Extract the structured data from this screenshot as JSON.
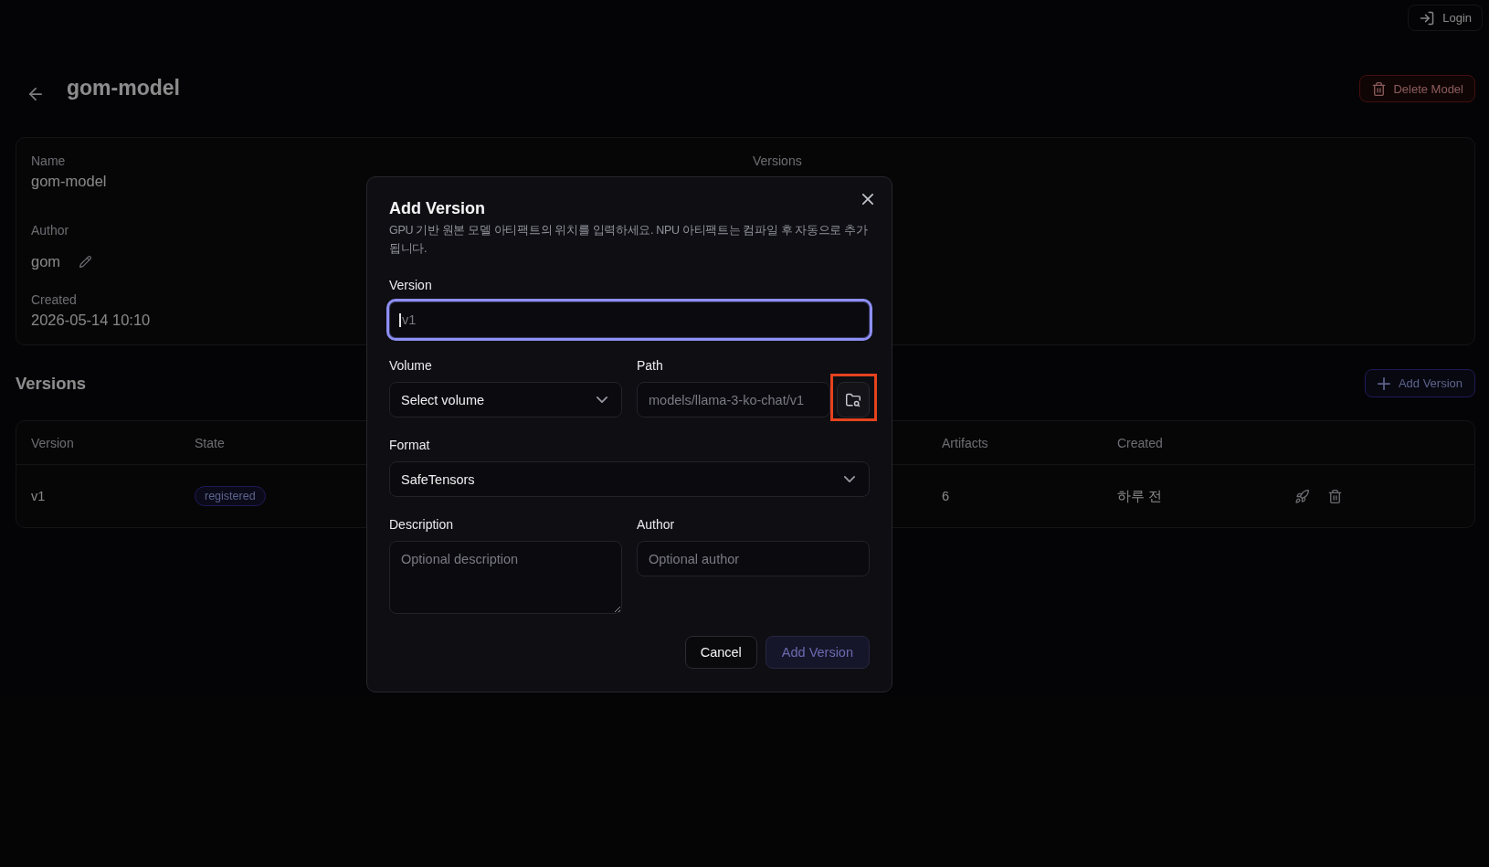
{
  "topbar": {
    "login_button": "Login"
  },
  "header": {
    "title": "gom-model",
    "delete_button": "Delete Model"
  },
  "details": {
    "left_column": [
      {
        "label": "Name",
        "value": "gom-model",
        "editable": false
      },
      {
        "label": "Author",
        "value": "gom",
        "editable": true
      },
      {
        "label": "Created",
        "value": "2026-05-14 10:10",
        "editable": false
      }
    ],
    "right_column": [
      {
        "label": "Versions"
      }
    ]
  },
  "versions": {
    "title": "Versions",
    "add_button": "Add Version",
    "table": {
      "columns": [
        "Version",
        "State",
        "Artifacts",
        "Created"
      ],
      "rows": [
        {
          "version": "v1",
          "state": "registered",
          "artifacts": "6",
          "created": "하루 전"
        }
      ]
    }
  },
  "dialog": {
    "title": "Add Version",
    "description": "GPU 기반 원본 모델 아티팩트의 위치를 입력하세요. NPU 아티팩트는 컴파일 후 자동으로 추가됩니다.",
    "rows": [
      [
        {
          "kind": "input",
          "label": "Version",
          "placeholder": "v1",
          "focused": true
        }
      ],
      [
        {
          "kind": "select",
          "label": "Volume",
          "value": "Select volume"
        },
        {
          "kind": "path",
          "label": "Path",
          "placeholder": "models/llama-3-ko-chat/v1",
          "highlighted": true
        }
      ],
      [
        {
          "kind": "select",
          "label": "Format",
          "value": "SafeTensors"
        }
      ],
      [
        {
          "kind": "textarea",
          "label": "Description",
          "placeholder": "Optional description"
        },
        {
          "kind": "input",
          "label": "Author",
          "placeholder": "Optional author",
          "focused": false
        }
      ]
    ],
    "buttons": [
      {
        "label": "Cancel",
        "kind": "secondary",
        "disabled": false
      },
      {
        "label": "Add Version",
        "kind": "primary",
        "disabled": true
      }
    ]
  }
}
